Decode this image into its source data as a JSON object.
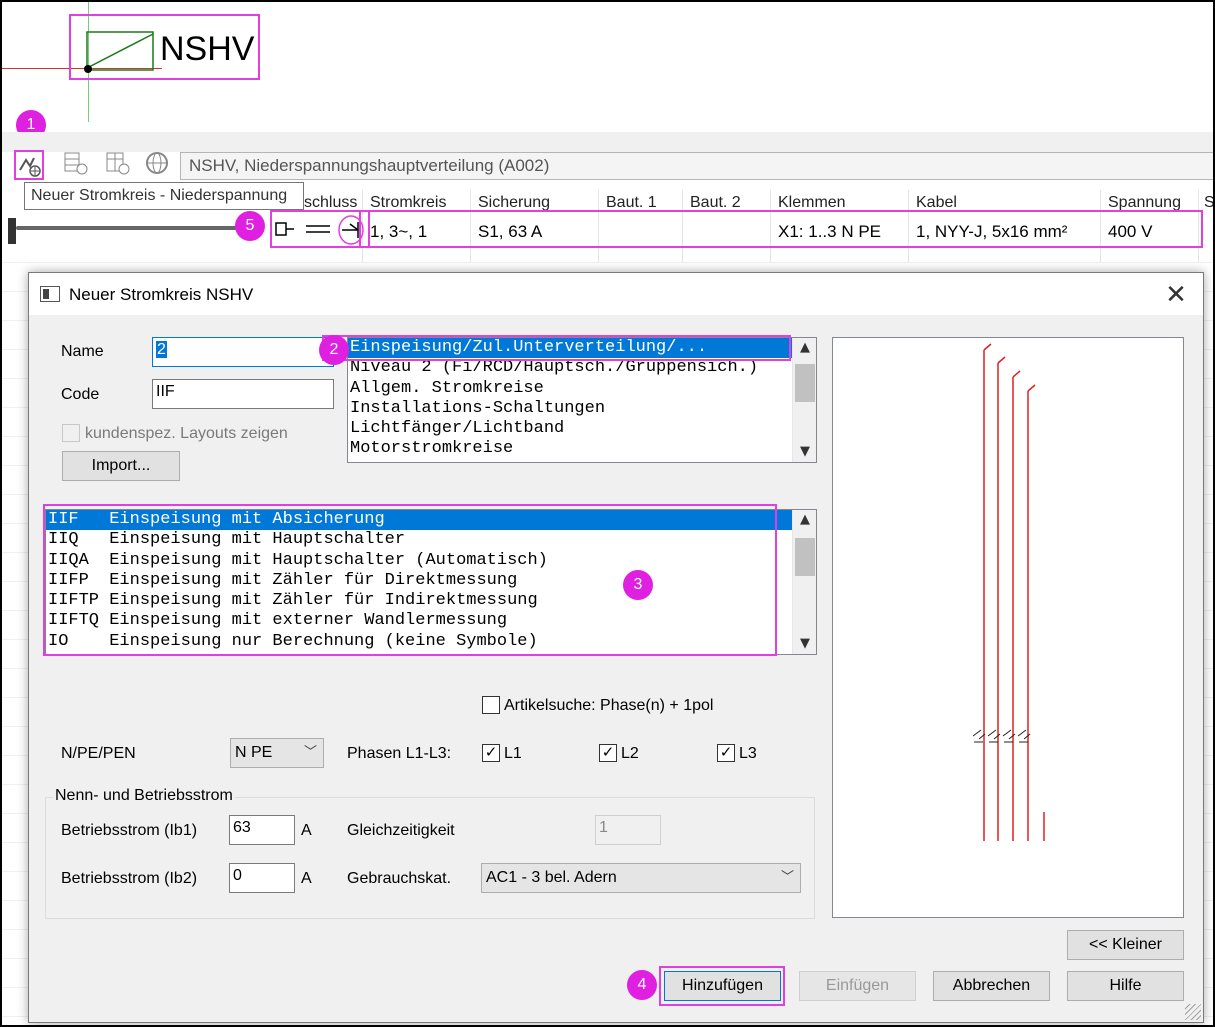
{
  "schematic": {
    "board_label": "NSHV"
  },
  "badges": [
    "1",
    "2",
    "3",
    "4",
    "5"
  ],
  "toolbar": {
    "path_text": "NSHV, Niederspannungshauptverteilung (A002)",
    "tooltip": "Neuer Stromkreis - Niederspannung"
  },
  "grid": {
    "headers": [
      "schluss",
      "Stromkreis",
      "Sicherung",
      "Baut. 1",
      "Baut. 2",
      "Klemmen",
      "Kabel",
      "Spannung",
      "S"
    ],
    "row": {
      "stromkreis": "1, 3~, 1",
      "sicherung": "S1, 63 A",
      "klemmen": "X1: 1..3 N PE",
      "kabel": "1, NYY-J, 5x16 mm²",
      "spannung": "400 V"
    }
  },
  "dialog": {
    "title": "Neuer Stromkreis  NSHV",
    "name_label": "Name",
    "name_value": "2",
    "code_label": "Code",
    "code_value": "IIF",
    "custom_layouts_label": "kundenspez. Layouts zeigen",
    "import_button": "Import...",
    "categories": [
      "Einspeisung/Zul.Unterverteilung/...",
      "Niveau 2 (Fi/RCD/Hauptsch./Gruppensich.)",
      "Allgem. Stromkreise",
      "Installations-Schaltungen",
      "Lichtfänger/Lichtband",
      "Motorstromkreise"
    ],
    "types": [
      "IIF   Einspeisung mit Absicherung",
      "IIQ   Einspeisung mit Hauptschalter",
      "IIQA  Einspeisung mit Hauptschalter (Automatisch)",
      "IIFP  Einspeisung mit Zähler für Direktmessung",
      "IIFTP Einspeisung mit Zähler für Indirektmessung",
      "IIFTQ Einspeisung mit externer Wandlermessung",
      "IO    Einspeisung nur Berechnung (keine Symbole)"
    ],
    "article_search_label": "Artikelsuche: Phase(n) + 1pol",
    "npe_label": "N/PE/PEN",
    "npe_value": "N PE",
    "phases_label": "Phasen L1-L3:",
    "phase_l1": "L1",
    "phase_l2": "L2",
    "phase_l3": "L3",
    "check_mark": "✓",
    "group_label": "Nenn- und Betriebsstrom",
    "ib1_label": "Betriebsstrom (Ib1)",
    "ib1_value": "63",
    "ib2_label": "Betriebsstrom (Ib2)",
    "ib2_value": "0",
    "unit_a": "A",
    "simultaneity_label": "Gleichzeitigkeit",
    "simultaneity_value": "1",
    "usage_label": "Gebrauchskat.",
    "usage_value": "AC1 - 3 bel. Adern",
    "smaller_button": "<< Kleiner",
    "add_button": "Hinzufügen",
    "insert_button": "Einfügen",
    "cancel_button": "Abbrechen",
    "help_button": "Hilfe"
  },
  "colors": {
    "highlight": "#e040e0",
    "selection": "#0078d7",
    "preview_lines": "#e02020"
  }
}
